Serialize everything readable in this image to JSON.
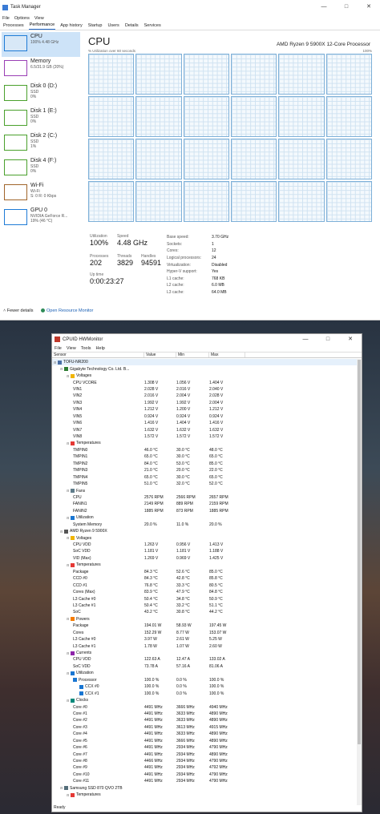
{
  "taskmanager": {
    "title": "Task Manager",
    "menu": [
      "File",
      "Options",
      "View"
    ],
    "tabs": [
      "Processes",
      "Performance",
      "App history",
      "Startup",
      "Users",
      "Details",
      "Services"
    ],
    "active_tab": "Performance",
    "sidebar": [
      {
        "name": "CPU",
        "sub1": "100% 4.48 GHz",
        "sub2": "",
        "color": "#1e7bd6"
      },
      {
        "name": "Memory",
        "sub1": "6.5/31.9 GB (20%)",
        "sub2": "",
        "color": "#9a3fb5"
      },
      {
        "name": "Disk 0 (D:)",
        "sub1": "SSD",
        "sub2": "0%",
        "color": "#4aa02c"
      },
      {
        "name": "Disk 1 (E:)",
        "sub1": "SSD",
        "sub2": "0%",
        "color": "#4aa02c"
      },
      {
        "name": "Disk 2 (C:)",
        "sub1": "SSD",
        "sub2": "1%",
        "color": "#4aa02c"
      },
      {
        "name": "Disk 4 (F:)",
        "sub1": "SSD",
        "sub2": "0%",
        "color": "#4aa02c"
      },
      {
        "name": "Wi-Fi",
        "sub1": "Wi-Fi",
        "sub2": "S: 0 R: 0 Kbps",
        "color": "#a0642a"
      },
      {
        "name": "GPU 0",
        "sub1": "NVIDIA GeForce R...",
        "sub2": "19% (46 °C)",
        "color": "#1e7bd6"
      }
    ],
    "cpu": {
      "heading": "CPU",
      "processor": "AMD Ryzen 9 5900X 12-Core Processor",
      "graph_label": "% Utilization over 60 seconds",
      "graph_max": "100%",
      "utilization_label": "Utilization",
      "utilization": "100%",
      "speed_label": "Speed",
      "speed": "4.48 GHz",
      "processes_label": "Processes",
      "processes": "202",
      "threads_label": "Threads",
      "threads": "3829",
      "handles_label": "Handles",
      "handles": "94591",
      "uptime_label": "Up time",
      "uptime": "0:00:23:27",
      "specs": [
        [
          "Base speed:",
          "3.70 GHz"
        ],
        [
          "Sockets:",
          "1"
        ],
        [
          "Cores:",
          "12"
        ],
        [
          "Logical processors:",
          "24"
        ],
        [
          "Virtualization:",
          "Disabled"
        ],
        [
          "Hyper-V support:",
          "Yes"
        ],
        [
          "L1 cache:",
          "768 KB"
        ],
        [
          "L2 cache:",
          "6.0 MB"
        ],
        [
          "L3 cache:",
          "64.0 MB"
        ]
      ]
    },
    "footer": {
      "fewer": "Fewer details",
      "open": "Open Resource Monitor"
    }
  },
  "hwmonitor": {
    "title": "CPUID HWMonitor",
    "menu": [
      "File",
      "View",
      "Tools",
      "Help"
    ],
    "columns": [
      "Sensor",
      "Value",
      "Min",
      "Max"
    ],
    "rows": [
      {
        "d": 0,
        "n": "TOFU-NR200",
        "v": "",
        "mi": "",
        "ma": "",
        "t": "pc"
      },
      {
        "d": 1,
        "n": "Gigabyte Technology Co. Ltd. B...",
        "v": "",
        "mi": "",
        "ma": "",
        "t": "board"
      },
      {
        "d": 2,
        "n": "Voltages",
        "v": "",
        "mi": "",
        "ma": "",
        "t": "volt"
      },
      {
        "d": 3,
        "n": "CPU VCORE",
        "v": "1.308 V",
        "mi": "1.056 V",
        "ma": "1.404 V"
      },
      {
        "d": 3,
        "n": "VIN1",
        "v": "2.028 V",
        "mi": "2.016 V",
        "ma": "2.040 V"
      },
      {
        "d": 3,
        "n": "VIN2",
        "v": "2.016 V",
        "mi": "2.004 V",
        "ma": "2.028 V"
      },
      {
        "d": 3,
        "n": "VIN3",
        "v": "1.992 V",
        "mi": "1.992 V",
        "ma": "2.004 V"
      },
      {
        "d": 3,
        "n": "VIN4",
        "v": "1.212 V",
        "mi": "1.200 V",
        "ma": "1.212 V"
      },
      {
        "d": 3,
        "n": "VIN5",
        "v": "0.924 V",
        "mi": "0.924 V",
        "ma": "0.924 V"
      },
      {
        "d": 3,
        "n": "VIN6",
        "v": "1.416 V",
        "mi": "1.404 V",
        "ma": "1.416 V"
      },
      {
        "d": 3,
        "n": "VIN7",
        "v": "1.632 V",
        "mi": "1.632 V",
        "ma": "1.632 V"
      },
      {
        "d": 3,
        "n": "VIN8",
        "v": "1.572 V",
        "mi": "1.572 V",
        "ma": "1.572 V"
      },
      {
        "d": 2,
        "n": "Temperatures",
        "v": "",
        "mi": "",
        "ma": "",
        "t": "temp"
      },
      {
        "d": 3,
        "n": "TMPIN0",
        "v": "46.0 °C",
        "mi": "30.0 °C",
        "ma": "48.0 °C"
      },
      {
        "d": 3,
        "n": "TMPIN1",
        "v": "65.0 °C",
        "mi": "30.0 °C",
        "ma": "65.0 °C"
      },
      {
        "d": 3,
        "n": "TMPIN2",
        "v": "84.0 °C",
        "mi": "53.0 °C",
        "ma": "85.0 °C"
      },
      {
        "d": 3,
        "n": "TMPIN3",
        "v": "21.0 °C",
        "mi": "20.0 °C",
        "ma": "22.0 °C"
      },
      {
        "d": 3,
        "n": "TMPIN4",
        "v": "65.0 °C",
        "mi": "30.0 °C",
        "ma": "65.0 °C"
      },
      {
        "d": 3,
        "n": "TMPIN5",
        "v": "51.0 °C",
        "mi": "32.0 °C",
        "ma": "52.0 °C"
      },
      {
        "d": 2,
        "n": "Fans",
        "v": "",
        "mi": "",
        "ma": "",
        "t": "fan"
      },
      {
        "d": 3,
        "n": "CPU",
        "v": "2576 RPM",
        "mi": "2566 RPM",
        "ma": "2657 RPM"
      },
      {
        "d": 3,
        "n": "FANIN1",
        "v": "2149 RPM",
        "mi": "889 RPM",
        "ma": "2159 RPM"
      },
      {
        "d": 3,
        "n": "FANIN2",
        "v": "1885 RPM",
        "mi": "873 RPM",
        "ma": "1885 RPM"
      },
      {
        "d": 2,
        "n": "Utilization",
        "v": "",
        "mi": "",
        "ma": "",
        "t": "util"
      },
      {
        "d": 3,
        "n": "System Memory",
        "v": "20.0 %",
        "mi": "11.0 %",
        "ma": "20.0 %"
      },
      {
        "d": 1,
        "n": "AMD Ryzen 9 5900X",
        "v": "",
        "mi": "",
        "ma": "",
        "t": "chip"
      },
      {
        "d": 2,
        "n": "Voltages",
        "v": "",
        "mi": "",
        "ma": "",
        "t": "volt"
      },
      {
        "d": 3,
        "n": "CPU VDD",
        "v": "1.263 V",
        "mi": "0.956 V",
        "ma": "1.413 V"
      },
      {
        "d": 3,
        "n": "SoC VDD",
        "v": "1.181 V",
        "mi": "1.181 V",
        "ma": "1.188 V"
      },
      {
        "d": 3,
        "n": "VID (Max)",
        "v": "1.269 V",
        "mi": "0.969 V",
        "ma": "1.425 V"
      },
      {
        "d": 2,
        "n": "Temperatures",
        "v": "",
        "mi": "",
        "ma": "",
        "t": "temp"
      },
      {
        "d": 3,
        "n": "Package",
        "v": "84.3 °C",
        "mi": "52.6 °C",
        "ma": "85.0 °C"
      },
      {
        "d": 3,
        "n": "CCD #0",
        "v": "84.3 °C",
        "mi": "42.8 °C",
        "ma": "85.8 °C"
      },
      {
        "d": 3,
        "n": "CCD #1",
        "v": "76.8 °C",
        "mi": "33.3 °C",
        "ma": "80.5 °C"
      },
      {
        "d": 3,
        "n": "Cores (Max)",
        "v": "83.9 °C",
        "mi": "47.9 °C",
        "ma": "84.8 °C"
      },
      {
        "d": 3,
        "n": "L3 Cache #0",
        "v": "50.4 °C",
        "mi": "34.8 °C",
        "ma": "50.9 °C"
      },
      {
        "d": 3,
        "n": "L3 Cache #1",
        "v": "50.4 °C",
        "mi": "33.2 °C",
        "ma": "51.1 °C"
      },
      {
        "d": 3,
        "n": "SoC",
        "v": "43.2 °C",
        "mi": "30.8 °C",
        "ma": "44.2 °C"
      },
      {
        "d": 2,
        "n": "Powers",
        "v": "",
        "mi": "",
        "ma": "",
        "t": "pow"
      },
      {
        "d": 3,
        "n": "Package",
        "v": "194.01 W",
        "mi": "58.93 W",
        "ma": "197.45 W"
      },
      {
        "d": 3,
        "n": "Cores",
        "v": "152.29 W",
        "mi": "8.77 W",
        "ma": "153.07 W"
      },
      {
        "d": 3,
        "n": "L3 Cache #0",
        "v": "3.97 W",
        "mi": "2.61 W",
        "ma": "5.25 W"
      },
      {
        "d": 3,
        "n": "L3 Cache #1",
        "v": "1.78 W",
        "mi": "1.07 W",
        "ma": "2.60 W"
      },
      {
        "d": 2,
        "n": "Currents",
        "v": "",
        "mi": "",
        "ma": "",
        "t": "cur"
      },
      {
        "d": 3,
        "n": "CPU VDD",
        "v": "122.63 A",
        "mi": "12.47 A",
        "ma": "133.02 A"
      },
      {
        "d": 3,
        "n": "SoC VDD",
        "v": "73.78 A",
        "mi": "57.16 A",
        "ma": "81.06 A"
      },
      {
        "d": 2,
        "n": "Utilization",
        "v": "",
        "mi": "",
        "ma": "",
        "t": "util"
      },
      {
        "d": 3,
        "n": "Processor",
        "v": "100.0 %",
        "mi": "0.0 %",
        "ma": "100.0 %",
        "t": "sub"
      },
      {
        "d": 4,
        "n": "CCX #0",
        "v": "100.0 %",
        "mi": "0.0 %",
        "ma": "100.0 %",
        "t": "sub"
      },
      {
        "d": 4,
        "n": "CCX #1",
        "v": "100.0 %",
        "mi": "0.0 %",
        "ma": "100.0 %",
        "t": "sub"
      },
      {
        "d": 2,
        "n": "Clocks",
        "v": "",
        "mi": "",
        "ma": "",
        "t": "clk"
      },
      {
        "d": 3,
        "n": "Core #0",
        "v": "4491 MHz",
        "mi": "3666 MHz",
        "ma": "4940 MHz"
      },
      {
        "d": 3,
        "n": "Core #1",
        "v": "4491 MHz",
        "mi": "3633 MHz",
        "ma": "4890 MHz"
      },
      {
        "d": 3,
        "n": "Core #2",
        "v": "4491 MHz",
        "mi": "3633 MHz",
        "ma": "4890 MHz"
      },
      {
        "d": 3,
        "n": "Core #3",
        "v": "4491 MHz",
        "mi": "3613 MHz",
        "ma": "4915 MHz"
      },
      {
        "d": 3,
        "n": "Core #4",
        "v": "4491 MHz",
        "mi": "3633 MHz",
        "ma": "4890 MHz"
      },
      {
        "d": 3,
        "n": "Core #5",
        "v": "4491 MHz",
        "mi": "3666 MHz",
        "ma": "4890 MHz"
      },
      {
        "d": 3,
        "n": "Core #6",
        "v": "4491 MHz",
        "mi": "2934 MHz",
        "ma": "4790 MHz"
      },
      {
        "d": 3,
        "n": "Core #7",
        "v": "4491 MHz",
        "mi": "2934 MHz",
        "ma": "4890 MHz"
      },
      {
        "d": 3,
        "n": "Core #8",
        "v": "4466 MHz",
        "mi": "2934 MHz",
        "ma": "4790 MHz"
      },
      {
        "d": 3,
        "n": "Core #9",
        "v": "4491 MHz",
        "mi": "2934 MHz",
        "ma": "4792 MHz"
      },
      {
        "d": 3,
        "n": "Core #10",
        "v": "4491 MHz",
        "mi": "2934 MHz",
        "ma": "4790 MHz"
      },
      {
        "d": 3,
        "n": "Core #11",
        "v": "4491 MHz",
        "mi": "2934 MHz",
        "ma": "4790 MHz"
      },
      {
        "d": 1,
        "n": "Samsung SSD 870 QVO 2TB",
        "v": "",
        "mi": "",
        "ma": "",
        "t": "disk"
      },
      {
        "d": 2,
        "n": "Temperatures",
        "v": "",
        "mi": "",
        "ma": "",
        "t": "temp"
      }
    ],
    "status": "Ready"
  }
}
